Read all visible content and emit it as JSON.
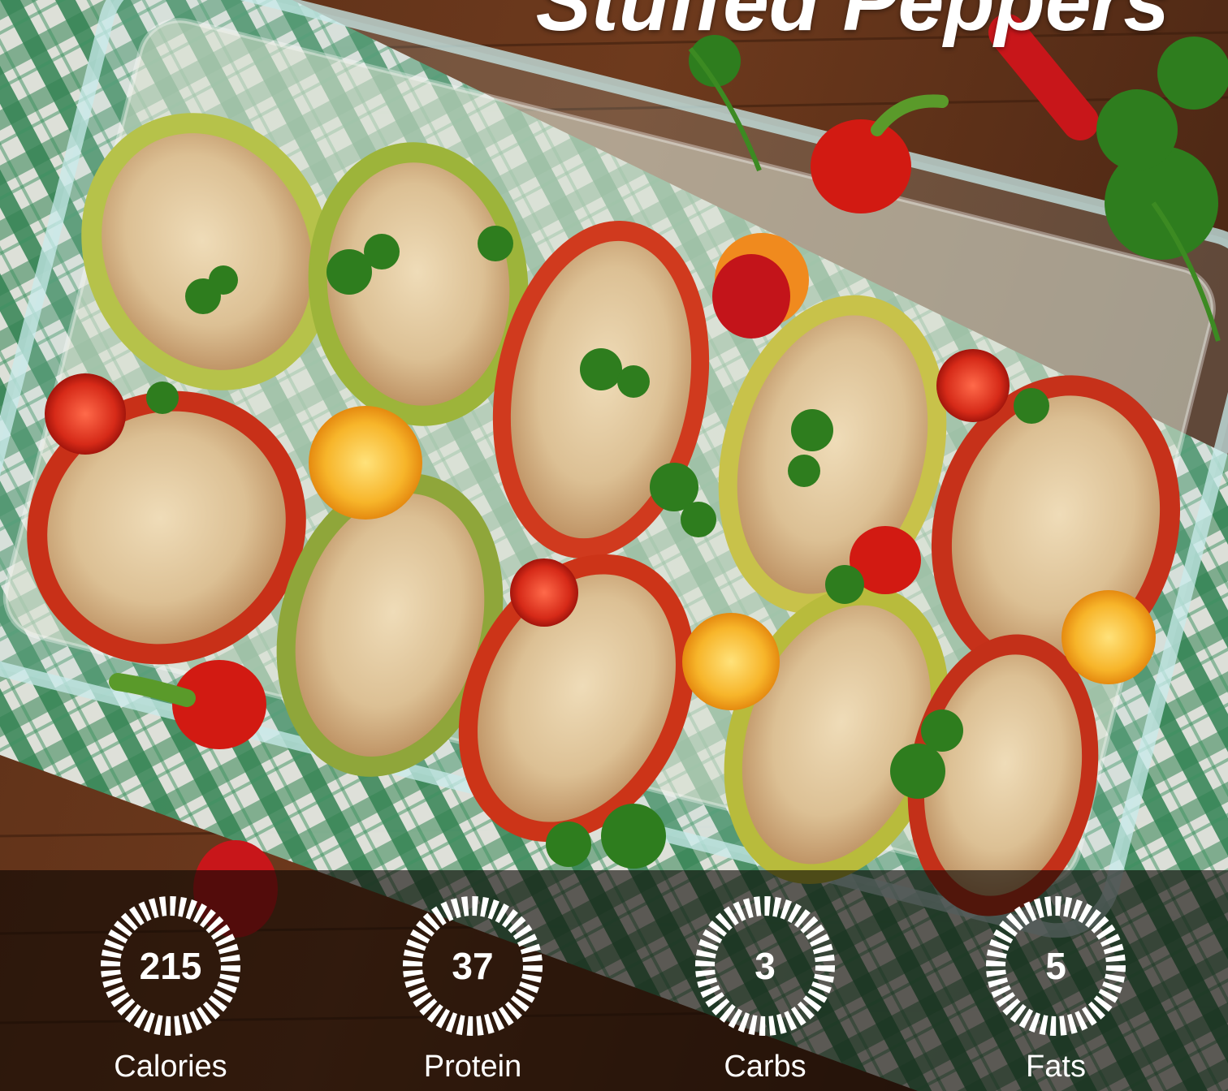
{
  "recipe": {
    "title": "Stuffed Peppers",
    "photo_icon": "stuffed-peppers-photo"
  },
  "nutrition": [
    {
      "label": "Calories",
      "value": "215"
    },
    {
      "label": "Protein",
      "value": "37"
    },
    {
      "label": "Carbs",
      "value": "3"
    },
    {
      "label": "Fats",
      "value": "5"
    }
  ],
  "colors": {
    "ring": "#ffffff",
    "text": "#ffffff",
    "overlay": "#0c0704"
  }
}
